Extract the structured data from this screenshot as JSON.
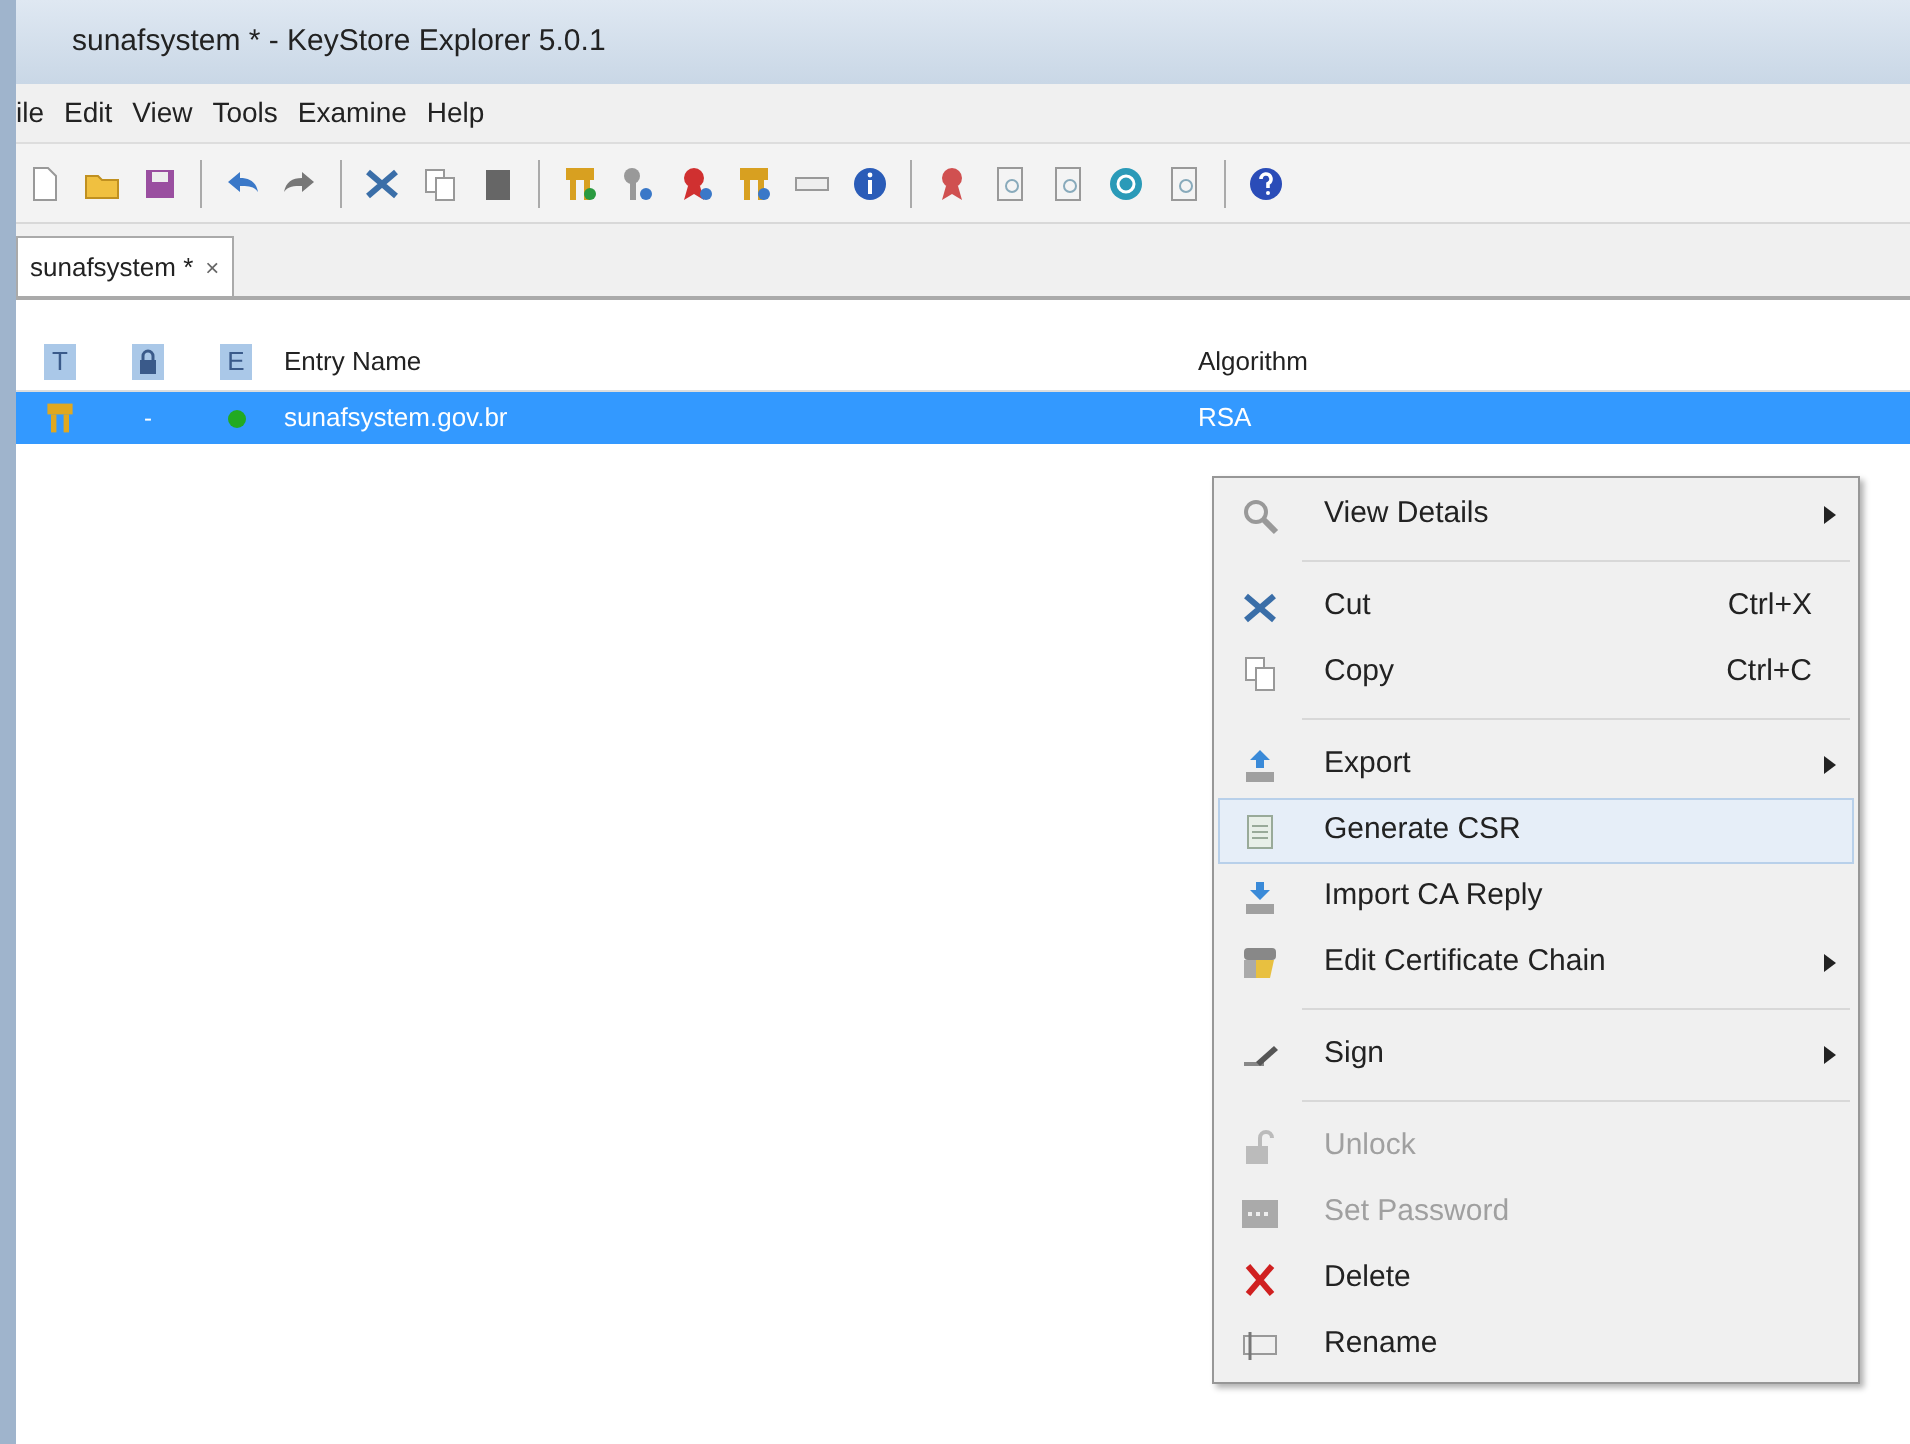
{
  "window": {
    "title": "sunafsystem * - KeyStore Explorer 5.0.1"
  },
  "menu_bar": [
    "ile",
    "Edit",
    "View",
    "Tools",
    "Examine",
    "Help"
  ],
  "tabs": [
    {
      "label": "sunafsystem *",
      "close": "×",
      "selected": true
    }
  ],
  "table": {
    "columns": [
      {
        "kind": "icon",
        "label": "T"
      },
      {
        "kind": "lock"
      },
      {
        "kind": "icon",
        "label": "E"
      },
      {
        "kind": "text",
        "label": "Entry Name"
      },
      {
        "kind": "text",
        "label": "Algorithm"
      }
    ],
    "rows": [
      {
        "selected": true,
        "lock": "-",
        "entry_name": "sunafsystem.gov.br",
        "algorithm": "RSA",
        "color": "#22aa22"
      }
    ]
  },
  "context_menu": [
    {
      "kind": "item",
      "label": "View Details",
      "submenu": true,
      "disabled": false,
      "selected": false
    },
    {
      "kind": "separator"
    },
    {
      "kind": "item",
      "label": "Cut",
      "shortcut": "Ctrl+X",
      "submenu": false,
      "disabled": false,
      "selected": false
    },
    {
      "kind": "item",
      "label": "Copy",
      "shortcut": "Ctrl+C",
      "submenu": false,
      "disabled": false,
      "selected": false
    },
    {
      "kind": "separator"
    },
    {
      "kind": "item",
      "label": "Export",
      "submenu": true,
      "disabled": false,
      "selected": false
    },
    {
      "kind": "item",
      "label": "Generate CSR",
      "submenu": false,
      "disabled": false,
      "selected": true
    },
    {
      "kind": "item",
      "label": "Import CA Reply",
      "submenu": false,
      "disabled": false,
      "selected": false
    },
    {
      "kind": "item",
      "label": "Edit Certificate Chain",
      "submenu": true,
      "disabled": false,
      "selected": false
    },
    {
      "kind": "separator"
    },
    {
      "kind": "item",
      "label": "Sign",
      "submenu": true,
      "disabled": false,
      "selected": false
    },
    {
      "kind": "separator"
    },
    {
      "kind": "item",
      "label": "Unlock",
      "submenu": false,
      "disabled": true,
      "selected": false
    },
    {
      "kind": "item",
      "label": "Set Password",
      "submenu": false,
      "disabled": true,
      "selected": false
    },
    {
      "kind": "item",
      "label": "Delete",
      "submenu": false,
      "disabled": false,
      "selected": false
    },
    {
      "kind": "item",
      "label": "Rename",
      "submenu": false,
      "disabled": false,
      "selected": false
    }
  ]
}
